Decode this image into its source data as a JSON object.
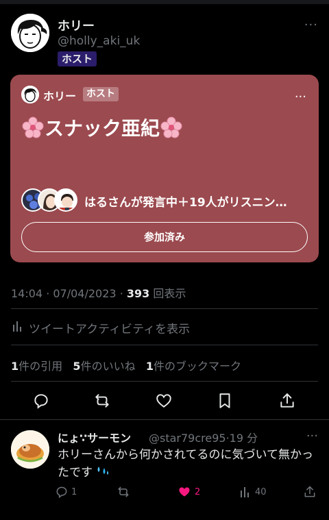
{
  "tweet": {
    "author_name": "ホリー",
    "author_handle": "@holly_aki_uk",
    "host_badge": "ホスト",
    "more": "···"
  },
  "space": {
    "host_name": "ホリー",
    "host_badge": "ホスト",
    "more": "···",
    "title": "スナック亜紀",
    "speaker_text": "はるさんが発言中＋19人がリスニン…",
    "joined_label": "参加済み",
    "card_color": "#9b4a4f"
  },
  "meta": {
    "time": "14:04",
    "date": "07/04/2023",
    "views_count": "393",
    "views_label": "回表示",
    "activity_label": "ツイートアクティビティを表示"
  },
  "stats": {
    "quotes_count": "1",
    "quotes_label": "件の引用",
    "likes_count": "5",
    "likes_label": "件のいいね",
    "bookmarks_count": "1",
    "bookmarks_label": "件のブックマーク"
  },
  "reply": {
    "name": "にょ∵サーモン",
    "handle_time": "@star79cre95·19 分",
    "text": "ホリーさんから何かされてるのに気づいて無かったです",
    "replies": "1",
    "likes": "2",
    "views": "40",
    "like_color": "#f91880"
  }
}
